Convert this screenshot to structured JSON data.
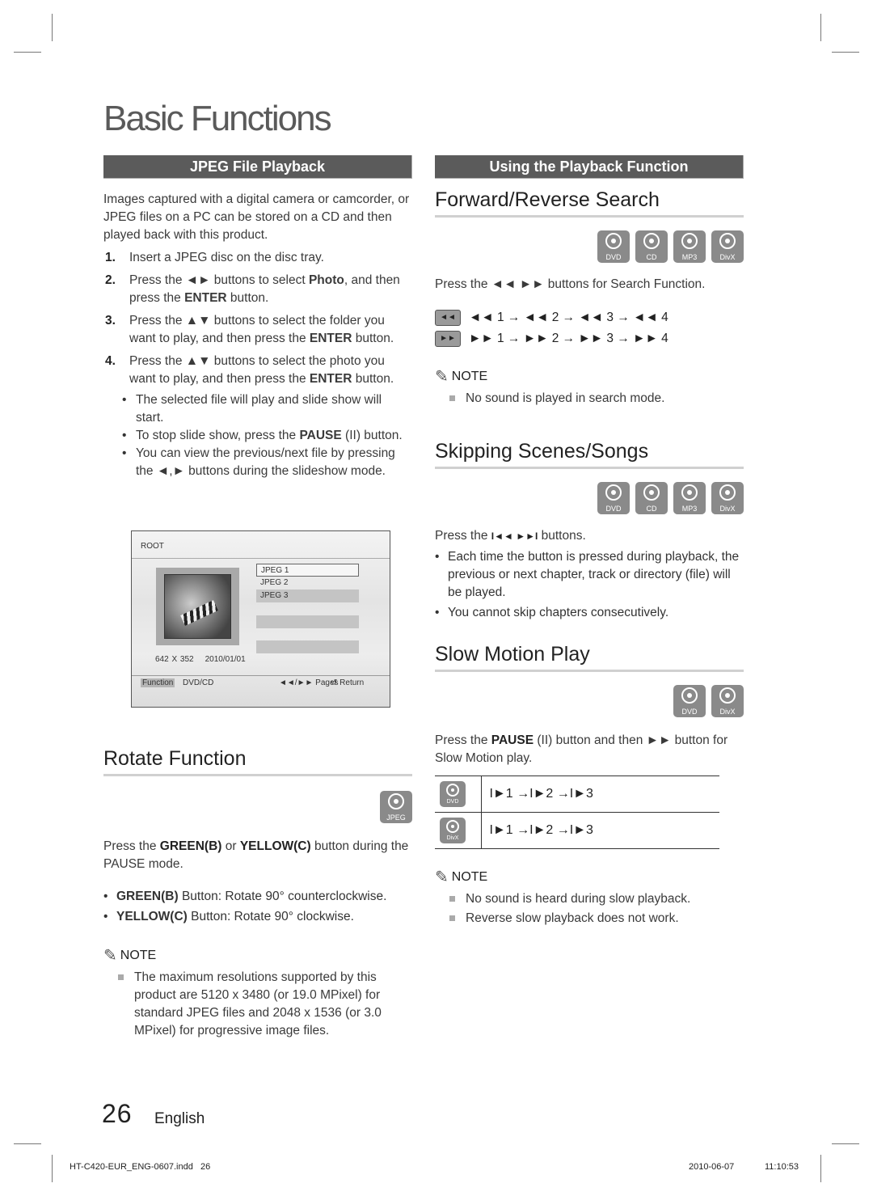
{
  "page": {
    "title": "Basic Functions",
    "page_number": "26",
    "language": "English",
    "slug_file": "HT-C420-EUR_ENG-0607.indd   26",
    "slug_date": "2010-06-07",
    "slug_time": "11:10:53"
  },
  "jpeg_playback": {
    "header": "JPEG File Playback",
    "intro": "Images captured with a digital camera or camcorder, or JPEG files on a PC can be stored on a CD and then played back with this product.",
    "steps": [
      {
        "num": "1.",
        "text": "Insert a JPEG disc on the disc tray."
      },
      {
        "num": "2.",
        "pre": "Press the ◄► buttons to select ",
        "b1": "Photo",
        "mid": ", and then press the ",
        "b2": "ENTER",
        "post": " button."
      },
      {
        "num": "3.",
        "pre": "Press the ▲▼ buttons to select the folder you want to play, and then press the ",
        "b1": "ENTER",
        "post": " button."
      },
      {
        "num": "4.",
        "pre": "Press the ▲▼ buttons to select the photo you want to play, and then press the ",
        "b1": "ENTER",
        "post": " button."
      }
    ],
    "bullets": [
      {
        "text": "The selected file will play and slide show will start."
      },
      {
        "pre": "To stop slide show, press the ",
        "b1": "PAUSE",
        "post": " (II) button."
      },
      {
        "text": "You can view the previous/next file by pressing the ◄,► buttons during the slideshow mode."
      }
    ],
    "screen": {
      "root_label": "ROOT",
      "files": [
        "JPEG 1",
        "JPEG 2",
        "JPEG 3"
      ],
      "resolution": "642 X 352",
      "date": "2010/01/01",
      "function_label": "Function",
      "source_label": "DVD/CD",
      "pages_label": "◄◄/►► Pages",
      "return_label": "↺ Return"
    }
  },
  "rotate": {
    "title": "Rotate Function",
    "disc_label": "JPEG",
    "intro_pre": "Press the ",
    "green": "GREEN(B)",
    "intro_mid": " or ",
    "yellow": "YELLOW(C)",
    "intro_post": " button during the PAUSE mode.",
    "bullets": [
      {
        "b": "GREEN(B)",
        "text": " Button: Rotate 90° counterclockwise."
      },
      {
        "b": "YELLOW(C)",
        "text": " Button: Rotate 90° clockwise."
      }
    ],
    "note_label": "NOTE",
    "notes": [
      "The maximum resolutions supported by this product are 5120 x 3480 (or 19.0 MPixel) for standard JPEG files and 2048 x 1536 (or 3.0 MPixel) for progressive image files."
    ]
  },
  "playback_function": {
    "header": "Using the Playback Function",
    "search": {
      "title": "Forward/Reverse Search",
      "discs": [
        "DVD",
        "CD",
        "MP3",
        "DivX"
      ],
      "instruction": "Press the ◄◄ ►► buttons for Search Function.",
      "rev_btn": "◄◄",
      "fwd_btn": "►►",
      "rev_seq": "◄◄ 1 → ◄◄ 2 → ◄◄ 3 → ◄◄ 4",
      "fwd_seq": "►► 1 → ►► 2 → ►► 3 → ►► 4",
      "note_label": "NOTE",
      "notes": [
        "No sound is played in search mode."
      ]
    },
    "skip": {
      "title": "Skipping Scenes/Songs",
      "discs": [
        "DVD",
        "CD",
        "MP3",
        "DivX"
      ],
      "instruction_pre": "Press the ",
      "instruction_icon": "I◄◄ ►►I",
      "instruction_post": " buttons.",
      "bullets": [
        "Each time the button is pressed during playback, the previous or next chapter, track or directory (file) will be played.",
        "You cannot skip chapters consecutively."
      ]
    },
    "slow": {
      "title": "Slow Motion Play",
      "discs": [
        "DVD",
        "DivX"
      ],
      "instruction_pre": "Press the ",
      "pause": "PAUSE",
      "instruction_post": " (II) button and then ►► button for Slow Motion play.",
      "rows": [
        {
          "disc": "DVD",
          "seq": "I►1 →I►2 →I►3"
        },
        {
          "disc": "DivX",
          "seq": "I►1 →I►2 →I►3"
        }
      ],
      "note_label": "NOTE",
      "notes": [
        "No sound is heard during slow playback.",
        "Reverse slow playback does not work."
      ]
    }
  }
}
